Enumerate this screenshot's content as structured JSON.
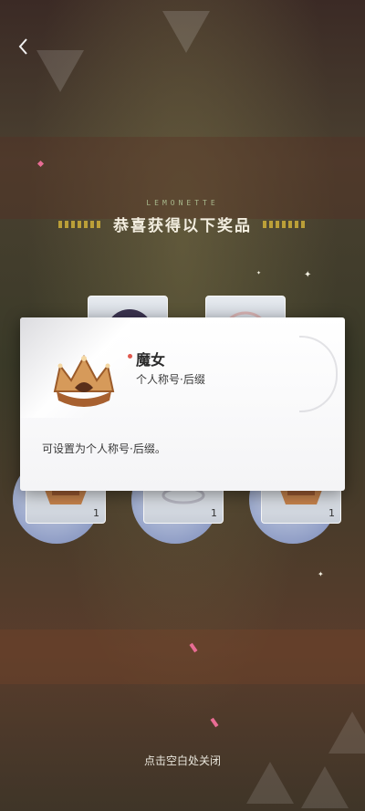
{
  "header": {
    "brand": "LEMONETTE",
    "title": "恭喜获得以下奖品"
  },
  "rewards": [
    {
      "icon": "crown-icon",
      "qty": "1"
    },
    {
      "icon": "ring-icon",
      "qty": "1"
    },
    {
      "icon": "crown-icon",
      "qty": "1"
    }
  ],
  "popup": {
    "name": "魔女",
    "type": "个人称号·后缀",
    "description": "可设置为个人称号·后缀。"
  },
  "footer": {
    "close_hint": "点击空白处关闭"
  },
  "colors": {
    "accent_gold": "#d6b53a",
    "popup_bg": "#ffffff",
    "name_dot": "#e0594f"
  }
}
